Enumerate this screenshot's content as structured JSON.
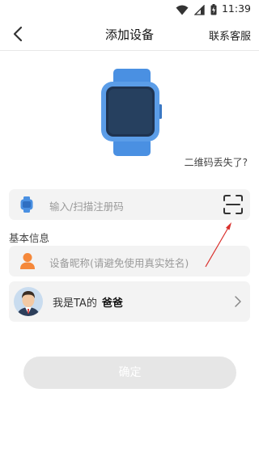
{
  "status_bar": {
    "time": "11:39"
  },
  "header": {
    "title": "添加设备",
    "service_label": "联系客服"
  },
  "lost_qr_text": "二维码丢失了?",
  "reg_input": {
    "placeholder": "输入/扫描注册码",
    "value": ""
  },
  "section_title": "基本信息",
  "nickname_input": {
    "placeholder": "设备昵称(请避免使用真实姓名)",
    "value": ""
  },
  "relation": {
    "prefix": "我是TA的",
    "value": "爸爸"
  },
  "confirm_label": "确定",
  "colors": {
    "watch_blue": "#4a90e2",
    "watch_face": "#1f3350",
    "person_orange": "#f5883a",
    "button_disabled": "#e6e6e6",
    "annotation_arrow": "#d9302c"
  },
  "icons": [
    "wifi-icon",
    "signal-icon",
    "battery-icon",
    "back-arrow-icon",
    "watch-image",
    "watch-icon",
    "scan-icon",
    "person-icon",
    "avatar",
    "chevron-right-icon"
  ]
}
